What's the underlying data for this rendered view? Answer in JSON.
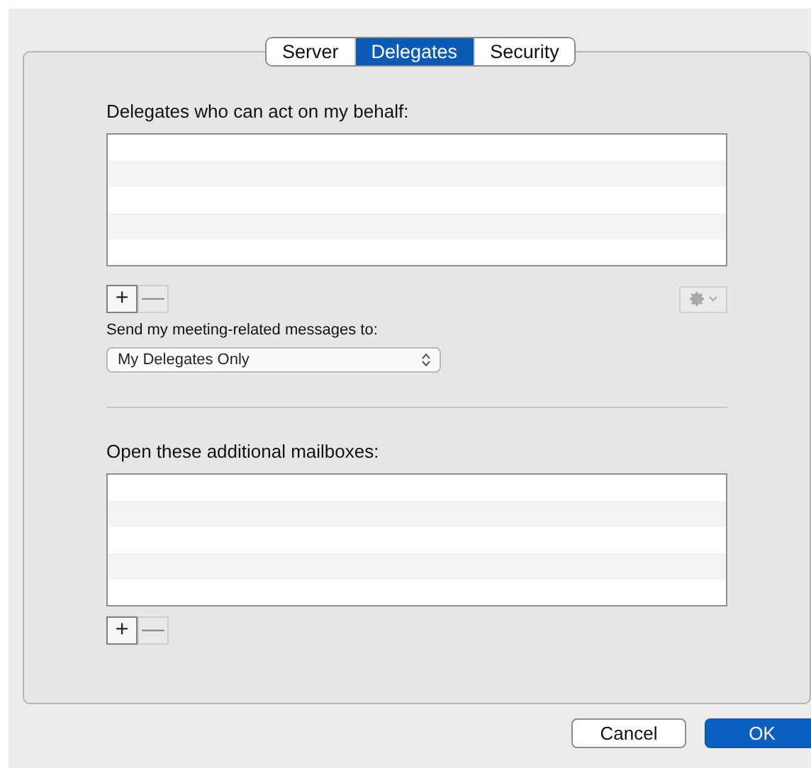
{
  "tabs": [
    {
      "label": "Server",
      "selected": false
    },
    {
      "label": "Delegates",
      "selected": true
    },
    {
      "label": "Security",
      "selected": false
    }
  ],
  "delegates": {
    "label": "Delegates who can act on my behalf:",
    "add_button": {
      "label": "+",
      "disabled": false
    },
    "remove_button": {
      "label": "—",
      "disabled": true
    },
    "action_button": {
      "disabled": true
    }
  },
  "meeting_messages": {
    "label": "Send my meeting-related messages to:",
    "value": "My Delegates Only"
  },
  "mailboxes": {
    "label": "Open these additional mailboxes:",
    "add_button": {
      "label": "+",
      "disabled": false
    },
    "remove_button": {
      "label": "—",
      "disabled": true
    }
  },
  "buttons": [
    {
      "label": "Cancel",
      "kind": "secondary"
    },
    {
      "label": "OK",
      "kind": "primary"
    }
  ]
}
